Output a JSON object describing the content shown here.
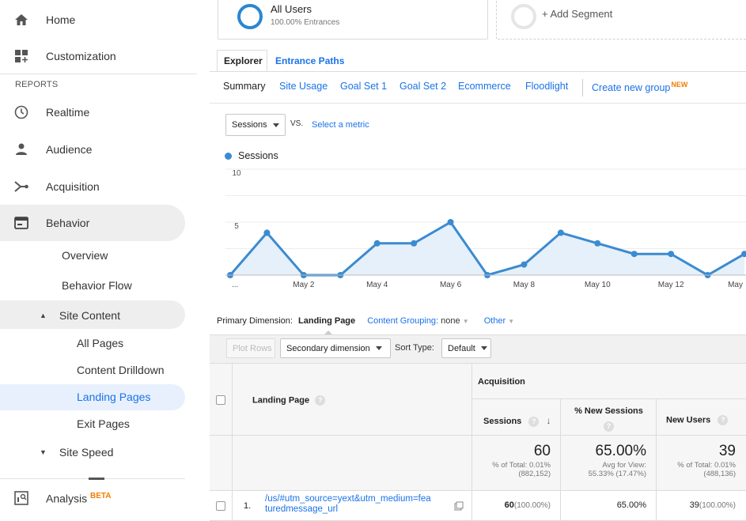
{
  "sidebar": {
    "home": "Home",
    "customization": "Customization",
    "reports_header": "REPORTS",
    "realtime": "Realtime",
    "audience": "Audience",
    "acquisition": "Acquisition",
    "behavior": "Behavior",
    "overview": "Overview",
    "behavior_flow": "Behavior Flow",
    "site_content": "Site Content",
    "all_pages": "All Pages",
    "content_drilldown": "Content Drilldown",
    "landing_pages": "Landing Pages",
    "exit_pages": "Exit Pages",
    "site_speed": "Site Speed",
    "analysis": "Analysis",
    "analysis_badge": "BETA",
    "colors": {
      "active_text": "#1a73e8",
      "active_bg": "#e8f0fe",
      "badge": "#f57c00"
    }
  },
  "segments": {
    "all_users": "All Users",
    "all_users_sub": "100.00% Entrances",
    "add_segment": "+ Add Segment"
  },
  "tabs": {
    "explorer": "Explorer",
    "entrance_paths": "Entrance Paths"
  },
  "subtabs": {
    "summary": "Summary",
    "site_usage": "Site Usage",
    "goal_set_1": "Goal Set 1",
    "goal_set_2": "Goal Set 2",
    "ecommerce": "Ecommerce",
    "floodlight": "Floodlight",
    "create_new_group": "Create new group",
    "new_badge": "NEW"
  },
  "metric": {
    "selected": "Sessions",
    "vs": "VS.",
    "select_metric": "Select a metric"
  },
  "chart_data": {
    "type": "line",
    "legend": "Sessions",
    "y_ticks": [
      "10",
      "5"
    ],
    "ylim": [
      0,
      10
    ],
    "x_tick_labels": [
      "...",
      "May 2",
      "May 4",
      "May 6",
      "May 8",
      "May 10",
      "May 12",
      "May"
    ],
    "series": [
      {
        "name": "Sessions",
        "values": [
          0,
          4,
          0,
          0,
          3,
          3,
          5,
          0,
          1,
          4,
          3,
          2,
          2,
          0,
          2
        ]
      }
    ],
    "color": "#3b8bd0"
  },
  "dimension": {
    "primary_label": "Primary Dimension:",
    "landing_page": "Landing Page",
    "content_grouping": "Content Grouping:",
    "content_grouping_value": "none",
    "other": "Other"
  },
  "toolbar": {
    "plot_rows": "Plot Rows",
    "secondary_dimension": "Secondary dimension",
    "sort_type_label": "Sort Type:",
    "sort_type_value": "Default"
  },
  "table": {
    "group_header": "Acquisition",
    "col_landing_page": "Landing Page",
    "col_sessions": "Sessions",
    "col_new_sessions": "% New Sessions",
    "col_new_users": "New Users",
    "totals": {
      "sessions": "60",
      "sessions_sub1": "% of Total: 0.01%",
      "sessions_sub2": "(882,152)",
      "new_sessions": "65.00%",
      "new_sessions_sub1": "Avg for View:",
      "new_sessions_sub2": "55.33% (17.47%)",
      "new_users": "39",
      "new_users_sub1": "% of Total: 0.01%",
      "new_users_sub2": "(488,136)"
    },
    "rows": [
      {
        "index": "1.",
        "page_line1": "/us/#utm_source=yext&utm_medium=fea",
        "page_line2": "turedmessage_url",
        "sessions": "60",
        "sessions_pct": "(100.00%)",
        "new_sessions": "65.00%",
        "new_users": "39",
        "new_users_pct": "(100.00%)"
      }
    ]
  }
}
